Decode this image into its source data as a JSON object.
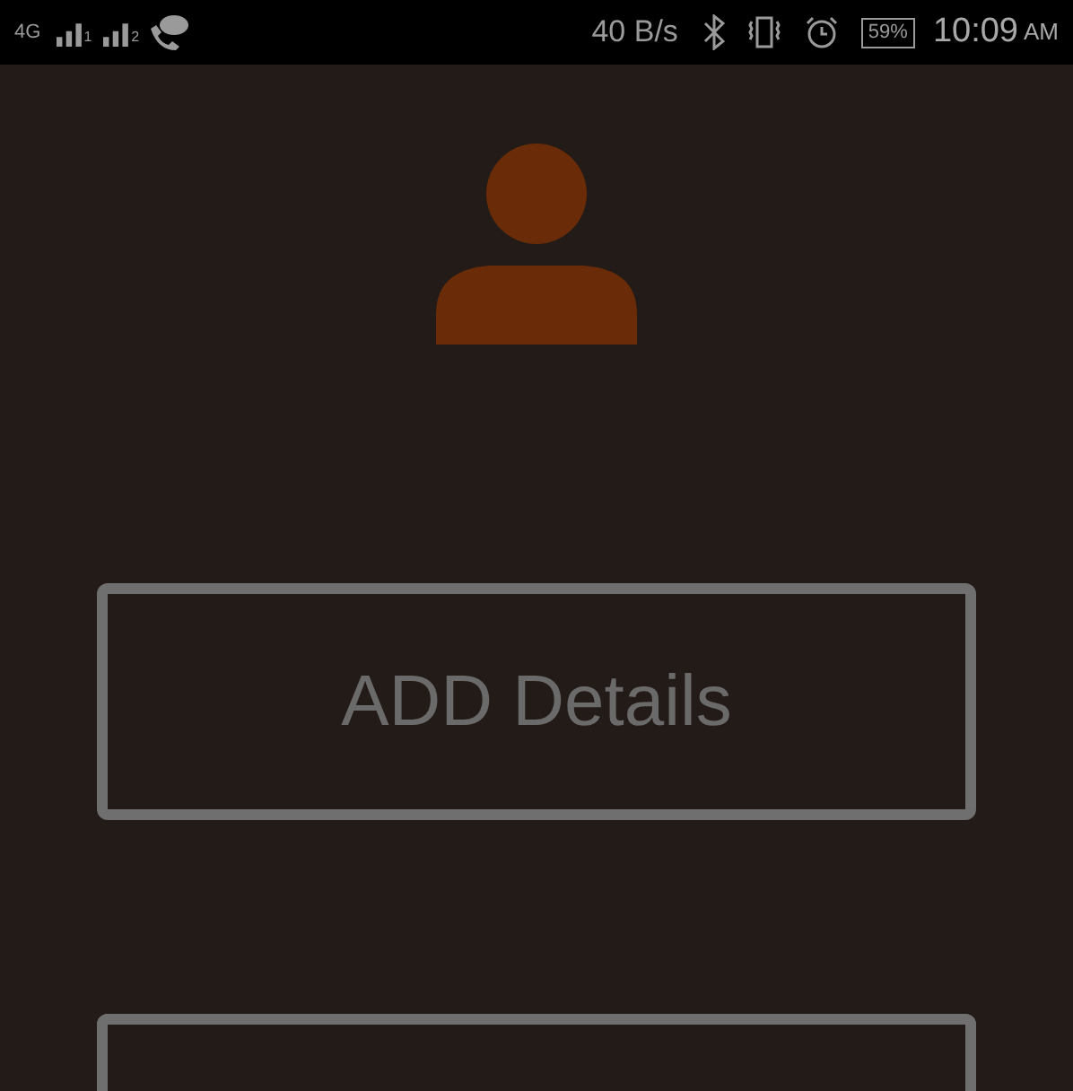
{
  "status_bar": {
    "network": "4G",
    "sim_1": "1",
    "sim_2": "2",
    "speed": "40 B/s",
    "battery": "59%",
    "time": "10:09",
    "ampm": "AM"
  },
  "buttons": [
    {
      "label": "ADD Details"
    },
    {
      "kind": "cut_off"
    }
  ]
}
